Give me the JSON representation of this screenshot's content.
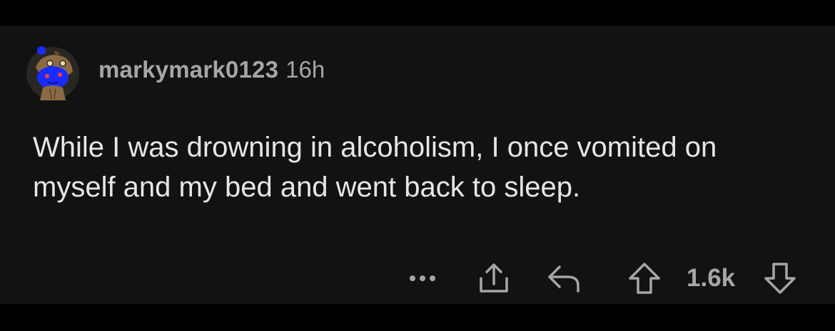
{
  "comment": {
    "username": "markymark0123",
    "age": "16h",
    "body": "While I was drowning in alcoholism, I once vomited on myself and my bed and went back to sleep.",
    "score": "1.6k"
  },
  "icons": {
    "avatar": "snoo-avatar",
    "more": "more-dots-icon",
    "share": "share-icon",
    "reply": "reply-icon",
    "upvote": "upvote-arrow-icon",
    "downvote": "downvote-arrow-icon"
  },
  "colors": {
    "background": "#000000",
    "card": "#121212",
    "meta_text": "#a6a6a6",
    "body_text": "#e6e6e6",
    "avatar_accent": "#1a2bff"
  }
}
